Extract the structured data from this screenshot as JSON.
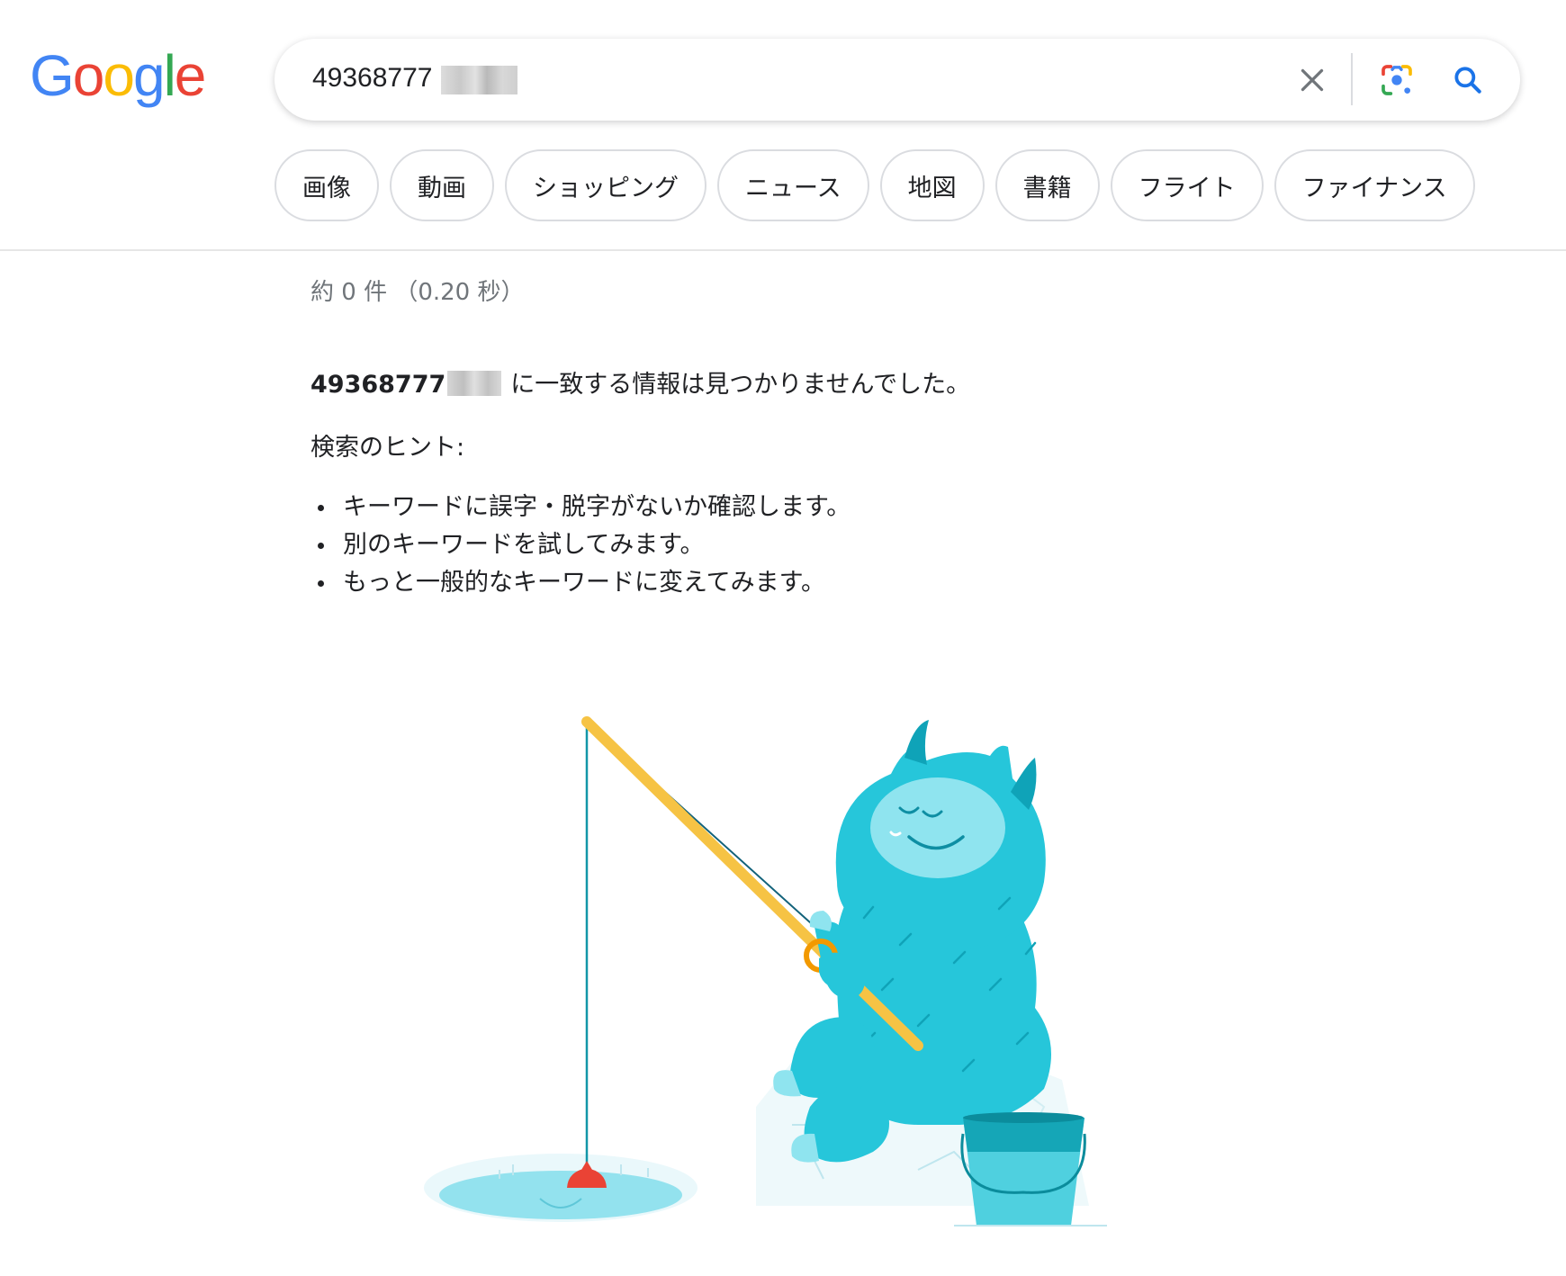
{
  "logo": {
    "letters": [
      {
        "char": "G",
        "color": "#4285F4"
      },
      {
        "char": "o",
        "color": "#EA4335"
      },
      {
        "char": "o",
        "color": "#FBBC05"
      },
      {
        "char": "g",
        "color": "#4285F4"
      },
      {
        "char": "l",
        "color": "#34A853"
      },
      {
        "char": "e",
        "color": "#EA4335"
      }
    ]
  },
  "search": {
    "query": "49368777",
    "icons": [
      "close-icon",
      "lens-icon",
      "search-icon"
    ]
  },
  "chips": [
    "画像",
    "動画",
    "ショッピング",
    "ニュース",
    "地図",
    "書籍",
    "フライト",
    "ファイナンス"
  ],
  "results": {
    "stats": "約 0 件 （0.20 秒）",
    "query_bold": "49368777",
    "no_match": "に一致する情報は見つかりませんでした。",
    "hints_title": "検索のヒント:",
    "hints": [
      "キーワードに誤字・脱字がないか確認します。",
      "別のキーワードを試してみます。",
      "もっと一般的なキーワードに変えてみます。"
    ]
  },
  "colors": {
    "accent_blue": "#1a73e8",
    "yeti": "#26c6da",
    "rod": "#f6c344",
    "bobber": "#ea4335"
  }
}
